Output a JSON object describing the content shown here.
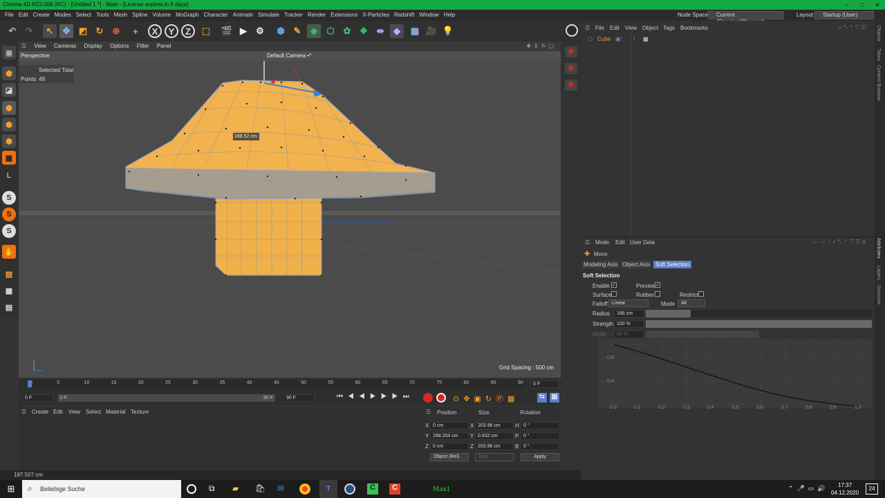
{
  "window": {
    "title": "Cinema 4D R23.008 (RC) - [Untitled 1 *] - Main - [License expires in 5 days]",
    "controls": [
      "–",
      "□",
      "✕"
    ]
  },
  "menu": {
    "items": [
      "File",
      "Edit",
      "Create",
      "Modes",
      "Select",
      "Tools",
      "Mesh",
      "Spline",
      "Volume",
      "MoGraph",
      "Character",
      "Animate",
      "Simulate",
      "Tracker",
      "Render",
      "Extensions",
      "X-Particles",
      "Redshift",
      "Window",
      "Help"
    ],
    "node_space_label": "Node Space:",
    "node_space_value": "Current (Standard/Physical)",
    "layout_label": "Layout:",
    "layout_value": "Startup (User)"
  },
  "viewport": {
    "menu": [
      "View",
      "Cameras",
      "Display",
      "Options",
      "Filter",
      "Panel"
    ],
    "name": "Perspective",
    "camera": "Default Camera",
    "camera_mark": "•*",
    "hud_header": "Selected Total",
    "hud_label": "Points",
    "hud_value": "49",
    "measure": "188.52 cm",
    "grid_spacing": "Grid Spacing : 500 cm"
  },
  "timeline": {
    "ticks": [
      "0",
      "5",
      "10",
      "15",
      "20",
      "25",
      "30",
      "35",
      "40",
      "45",
      "50",
      "55",
      "60",
      "65",
      "70",
      "75",
      "80",
      "85",
      "90"
    ],
    "current_frame": "0 F",
    "start": "0 F",
    "min": "0 F",
    "max": "90 F",
    "end": "90 F"
  },
  "material_menu": [
    "Create",
    "Edit",
    "View",
    "Select",
    "Material",
    "Texture"
  ],
  "coords": {
    "headers": [
      "Position",
      "Size",
      "Rotation"
    ],
    "rows": [
      {
        "axis": "X",
        "pos": "0 cm",
        "size_axis": "X",
        "size": "203.96 cm",
        "rot_axis": "H",
        "rot": "0 °"
      },
      {
        "axis": "Y",
        "pos": "288.204 cm",
        "size_axis": "Y",
        "size": "0.632 cm",
        "rot_axis": "P",
        "rot": "0 °"
      },
      {
        "axis": "Z",
        "pos": "0 cm",
        "size_axis": "Z",
        "size": "203.96 cm",
        "rot_axis": "B",
        "rot": "0 °"
      }
    ],
    "mode": "Object (Rel)",
    "size_mode": "Size",
    "apply": "Apply"
  },
  "status": "187.507 cm",
  "objects": {
    "menu": [
      "File",
      "Edit",
      "View",
      "Object",
      "Tags",
      "Bookmarks"
    ],
    "items": [
      {
        "name": "Cube"
      }
    ]
  },
  "attributes": {
    "menu": [
      "Mode",
      "Edit",
      "User Data"
    ],
    "tool": "Move",
    "tabs": [
      "Modeling Axis",
      "Object Axis",
      "Soft Selection"
    ],
    "section": "Soft Selection",
    "enable_label": "Enable",
    "enable": "✓",
    "preview_label": "Preview",
    "preview": "✓",
    "surface_label": "Surface",
    "rubber_label": "Rubber",
    "restrict_label": "Restrict",
    "falloff_label": "Falloff",
    "falloff_value": "Linear",
    "mode_label": "Mode",
    "mode_value": "All",
    "radius_label": "Radius",
    "radius_value": "188 cm",
    "radius_fill": 0.2,
    "strength_label": "Strength",
    "strength_value": "100 %",
    "strength_fill": 1.0,
    "width_label": "Width . .",
    "width_value": "50 %",
    "width_fill": 0.5,
    "graph_y": [
      "0.8",
      "0.4"
    ],
    "graph_x": [
      "0.0",
      "0.1",
      "0.2",
      "0.3",
      "0.4",
      "0.5",
      "0.6",
      "0.7",
      "0.8",
      "0.9",
      "1.0"
    ]
  },
  "side_tabs": [
    "Objects",
    "Takes",
    "Content Browser",
    "Attributes",
    "Layers",
    "Structure"
  ],
  "taskbar": {
    "search_placeholder": "Beliebige Suche",
    "time": "17:37",
    "date": "04.12.2020",
    "notification_count": "24",
    "app_label": "Max1"
  },
  "colors": {
    "title_bar": "#14a843",
    "mesh": "#f2b24e",
    "selection_tab": "#5b7fc7",
    "accent_red": "#d62828"
  }
}
